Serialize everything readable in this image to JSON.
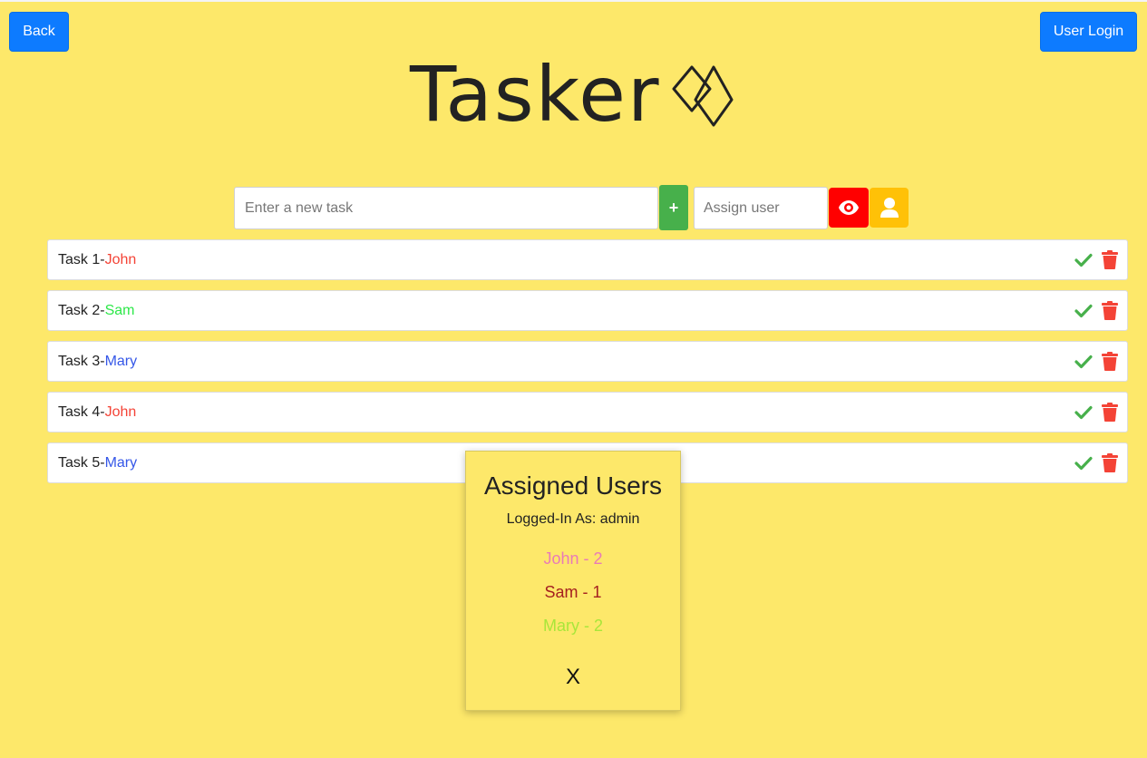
{
  "header": {
    "back_label": "Back",
    "login_label": "User Login",
    "logo_text": "Tasker"
  },
  "form": {
    "task_placeholder": "Enter a new task",
    "add_label": "+",
    "user_placeholder": "Assign user"
  },
  "tasks": [
    {
      "name": "Task 1",
      "separator": " - ",
      "user": "John",
      "color": "#f44336"
    },
    {
      "name": "Task 2",
      "separator": " - ",
      "user": "Sam",
      "color": "#2ee84a"
    },
    {
      "name": "Task 3",
      "separator": " - ",
      "user": "Mary",
      "color": "#3557e8"
    },
    {
      "name": "Task 4",
      "separator": " - ",
      "user": "John",
      "color": "#f44336"
    },
    {
      "name": "Task 5",
      "separator": " - ",
      "user": "Mary",
      "color": "#3557e8"
    }
  ],
  "icons": {
    "complete": "check-icon",
    "delete": "trash-icon",
    "view": "eye-icon",
    "users": "person-icon"
  },
  "colors": {
    "background": "#fde86a",
    "primary": "#0d7bff",
    "add": "#47b04b",
    "view": "#ff0000",
    "users": "#ffc107",
    "check": "#47b04b",
    "delete": "#f44336"
  },
  "modal": {
    "title": "Assigned Users",
    "subtitle": "Logged-In As: admin",
    "users": [
      {
        "label": "John - 2",
        "color": "#e97ab8"
      },
      {
        "label": "Sam - 1",
        "color": "#a52020"
      },
      {
        "label": "Mary - 2",
        "color": "#a8e63a"
      }
    ],
    "close_label": "X"
  }
}
